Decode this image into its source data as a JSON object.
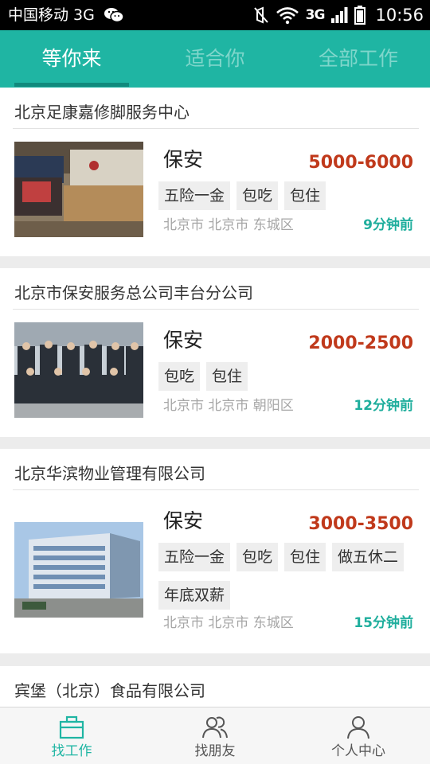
{
  "status_bar": {
    "carrier": "中国移动 3G",
    "network": "3G",
    "time": "10:56",
    "icons": [
      "wechat-icon",
      "mute-icon",
      "wifi-icon",
      "signal-icon",
      "battery-icon"
    ]
  },
  "tabs": [
    {
      "label": "等你来",
      "active": true
    },
    {
      "label": "适合你",
      "active": false
    },
    {
      "label": "全部工作",
      "active": false
    }
  ],
  "jobs": [
    {
      "company": "北京足康嘉修脚服务中心",
      "title": "保安",
      "salary": "5000-6000",
      "tags": [
        "五险一金",
        "包吃",
        "包住"
      ],
      "location": "北京市 北京市 东城区",
      "posted": "9分钟前"
    },
    {
      "company": "北京市保安服务总公司丰台分公司",
      "title": "保安",
      "salary": "2000-2500",
      "tags": [
        "包吃",
        "包住"
      ],
      "location": "北京市 北京市 朝阳区",
      "posted": "12分钟前"
    },
    {
      "company": "北京华滨物业管理有限公司",
      "title": "保安",
      "salary": "3000-3500",
      "tags": [
        "五险一金",
        "包吃",
        "包住",
        "做五休二",
        "年底双薪"
      ],
      "location": "北京市 北京市 东城区",
      "posted": "15分钟前"
    },
    {
      "company": "宾堡（北京）食品有限公司"
    }
  ],
  "bottom_nav": [
    {
      "label": "找工作",
      "icon": "briefcase-icon",
      "active": true
    },
    {
      "label": "找朋友",
      "icon": "friends-icon",
      "active": false
    },
    {
      "label": "个人中心",
      "icon": "person-icon",
      "active": false
    }
  ],
  "colors": {
    "accent": "#1fb5a3",
    "salary": "#c0391b",
    "posted": "#1fae9d"
  }
}
